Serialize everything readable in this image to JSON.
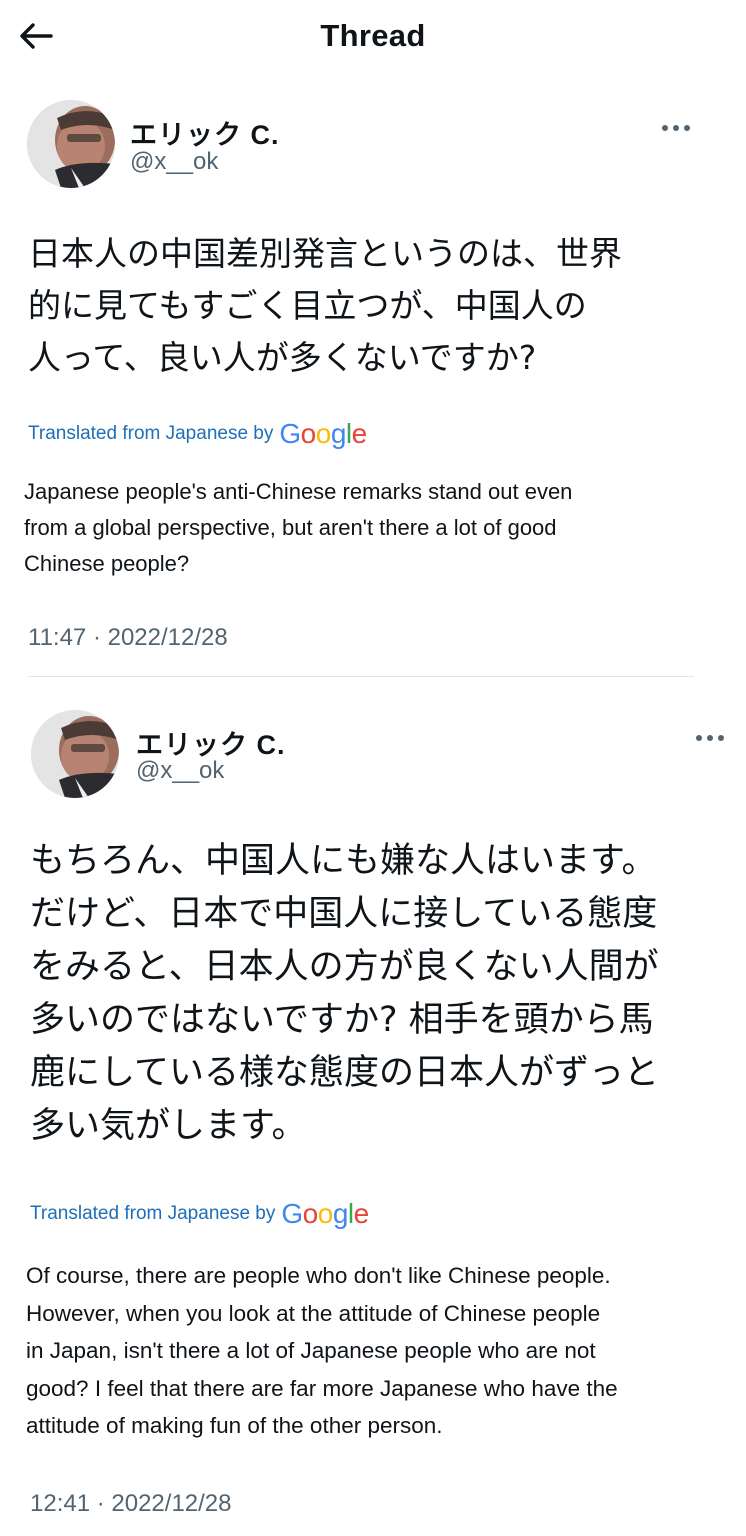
{
  "header": {
    "title": "Thread",
    "back_icon": "arrow-left-icon"
  },
  "tweets": [
    {
      "author_name": "エリック C.",
      "author_handle": "@x__ok",
      "original_text": "日本人の中国差別発言というのは、世界的に見てもすごく目立つが、中国人の人って、良い人が多くないですか?",
      "original_lines": [
        "日本人の中国差別発言というのは、世界",
        "的に見てもすごく目立つが、中国人の",
        "人って、良い人が多くないですか?"
      ],
      "translated_label": "Translated from Japanese by",
      "translated_provider": "Google",
      "translation_lines": [
        "Japanese people's anti-Chinese remarks stand out even",
        "from a global perspective, but aren't there a lot of good",
        "Chinese people?"
      ],
      "timestamp": "11:47 · 2022/12/28"
    },
    {
      "author_name": "エリック C.",
      "author_handle": "@x__ok",
      "original_text": "もちろん、中国人にも嫌な人はいます。だけど、日本で中国人に接している態度をみると、日本人の方が良くない人間が多いのではないですか? 相手を頭から馬鹿にしている様な態度の日本人がずっと多い気がします。",
      "original_lines": [
        "もちろん、中国人にも嫌な人はいます。",
        "だけど、日本で中国人に接している態度",
        "をみると、日本人の方が良くない人間が",
        "多いのではないですか? 相手を頭から馬",
        "鹿にしている様な態度の日本人がずっと",
        "多い気がします。"
      ],
      "translated_label": "Translated from Japanese by",
      "translated_provider": "Google",
      "translation_lines": [
        "Of course, there are people who don't like Chinese people.",
        "However, when you look at the attitude of Chinese people",
        "in Japan, isn't there a lot of Japanese people who are not",
        "good? I feel that there are far more Japanese who have the",
        "attitude of making fun of the other person."
      ],
      "timestamp": "12:41 · 2022/12/28"
    }
  ],
  "colors": {
    "link_blue": "#1d6fb8",
    "secondary_text": "#536471",
    "google_blue": "#4285F4",
    "google_red": "#EA4335",
    "google_yellow": "#FBBC05",
    "google_green": "#34A853"
  }
}
